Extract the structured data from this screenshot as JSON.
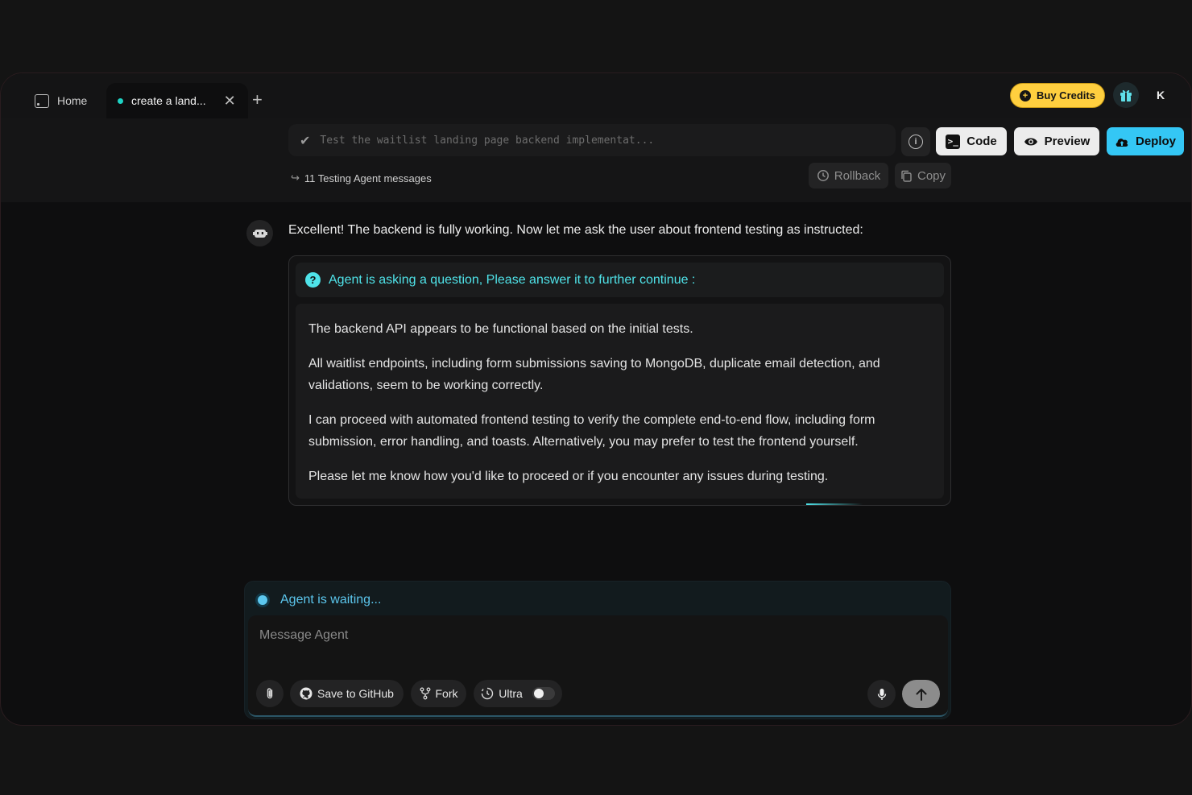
{
  "tabs": {
    "home_label": "Home",
    "active_label": "create a land...",
    "close_symbol": "✕",
    "add_symbol": "+"
  },
  "header": {
    "buy_credits": "Buy Credits",
    "avatar_initial": "K"
  },
  "task": {
    "text": "Test the waitlist landing page backend implementat...",
    "subagent_messages": "11 Testing Agent messages"
  },
  "toolbar": {
    "code": "Code",
    "preview": "Preview",
    "deploy": "Deploy",
    "rollback": "Rollback",
    "copy": "Copy"
  },
  "chat": {
    "agent_message": "Excellent! The backend is fully working. Now let me ask the user about frontend testing as instructed:",
    "question_header": "Agent is asking a question, Please answer it to further continue :",
    "question_paragraphs": [
      "The backend API appears to be functional based on the initial tests.",
      "All waitlist endpoints, including form submissions saving to MongoDB, duplicate email detection, and validations, seem to be working correctly.",
      "I can proceed with automated frontend testing to verify the complete end-to-end flow, including form submission, error handling, and toasts. Alternatively, you may prefer to test the frontend yourself.",
      "Please let me know how you'd like to proceed or if you encounter any issues during testing."
    ]
  },
  "composer": {
    "status": "Agent is waiting...",
    "placeholder": "Message Agent",
    "save_github": "Save to GitHub",
    "fork": "Fork",
    "ultra": "Ultra"
  },
  "colors": {
    "accent_cyan": "#4fe3e9",
    "deploy_blue": "#34c7f5",
    "credits_yellow": "#ffcf3f",
    "status_blue": "#5cc7ee"
  },
  "icons": [
    "home-icon",
    "close-icon",
    "plus-icon",
    "coin-icon",
    "gift-icon",
    "check-icon",
    "info-icon",
    "terminal-icon",
    "eye-icon",
    "cloud-upload-icon",
    "subdirectory-arrow-icon",
    "history-icon",
    "copy-icon",
    "robot-icon",
    "question-icon",
    "paperclip-icon",
    "github-icon",
    "fork-icon",
    "ultra-icon",
    "mic-icon",
    "arrow-up-icon"
  ]
}
